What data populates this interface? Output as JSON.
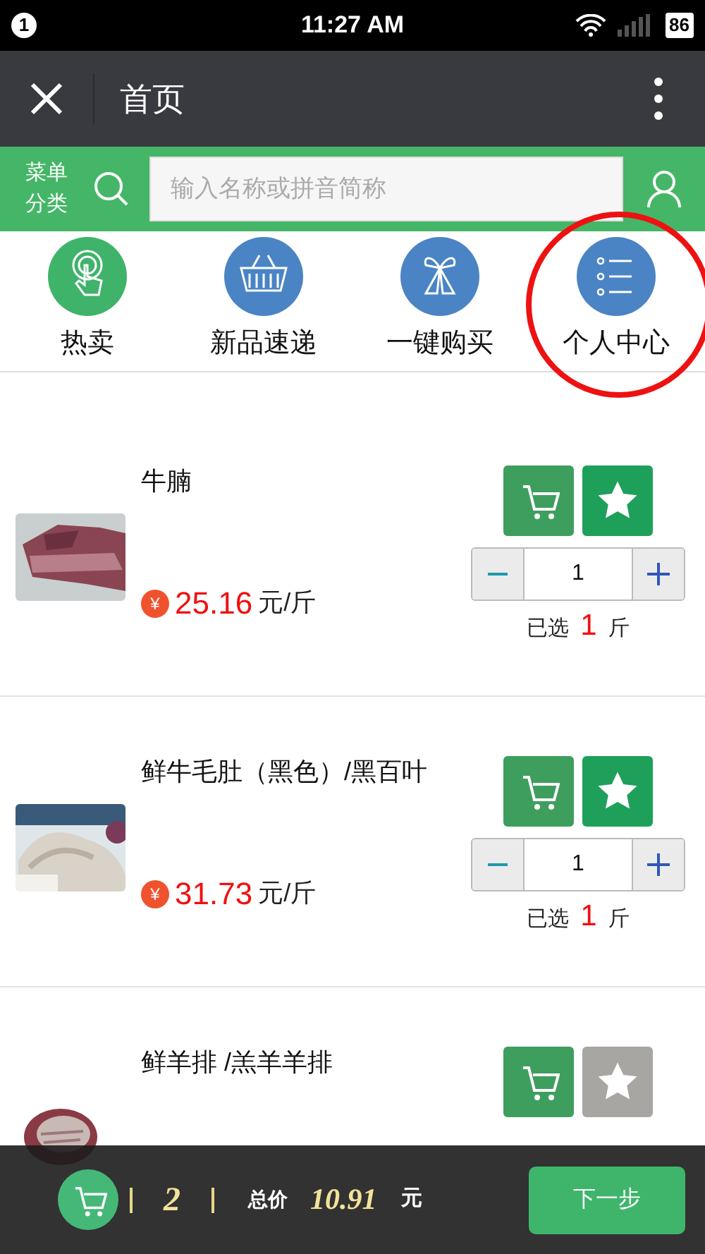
{
  "status_bar": {
    "notification": "1",
    "time": "11:27 AM",
    "battery": "86"
  },
  "title_bar": {
    "title": "首页"
  },
  "search_bar": {
    "menu_label": [
      "菜单",
      "分类"
    ],
    "placeholder": "输入名称或拼音简称"
  },
  "nav": [
    {
      "label": "热卖",
      "kind": "hot",
      "color": "#3fb36a",
      "highlighted": false
    },
    {
      "label": "新品速递",
      "kind": "basket",
      "color": "#4a84c4",
      "highlighted": false
    },
    {
      "label": "一键购买",
      "kind": "gift",
      "color": "#4a84c4",
      "highlighted": false
    },
    {
      "label": "个人中心",
      "kind": "list",
      "color": "#4a84c4",
      "highlighted": true
    }
  ],
  "products": [
    {
      "name": "牛腩",
      "currency": "¥",
      "price": "25.16",
      "unit": "元/斤",
      "favorite": true,
      "quantity": "1",
      "selected": [
        "已选",
        "1",
        "斤"
      ],
      "picture": {
        "kind": "picture"
      }
    },
    {
      "name": "鲜牛毛肚（黑色）/黑百叶",
      "currency": "¥",
      "price": "31.73",
      "unit": "元/斤",
      "favorite": true,
      "quantity": "1",
      "selected": [
        "已选",
        "1",
        "斤"
      ],
      "picture": {
        "kind": "picture"
      }
    },
    {
      "name": "鲜羊排 /羔羊羊排",
      "favorite": false,
      "picture": {
        "kind": "picture"
      }
    }
  ],
  "cart_bar": {
    "count": "2",
    "total_label": "总价",
    "total": "10.91",
    "total_unit": "元",
    "next_button": "下一步"
  }
}
